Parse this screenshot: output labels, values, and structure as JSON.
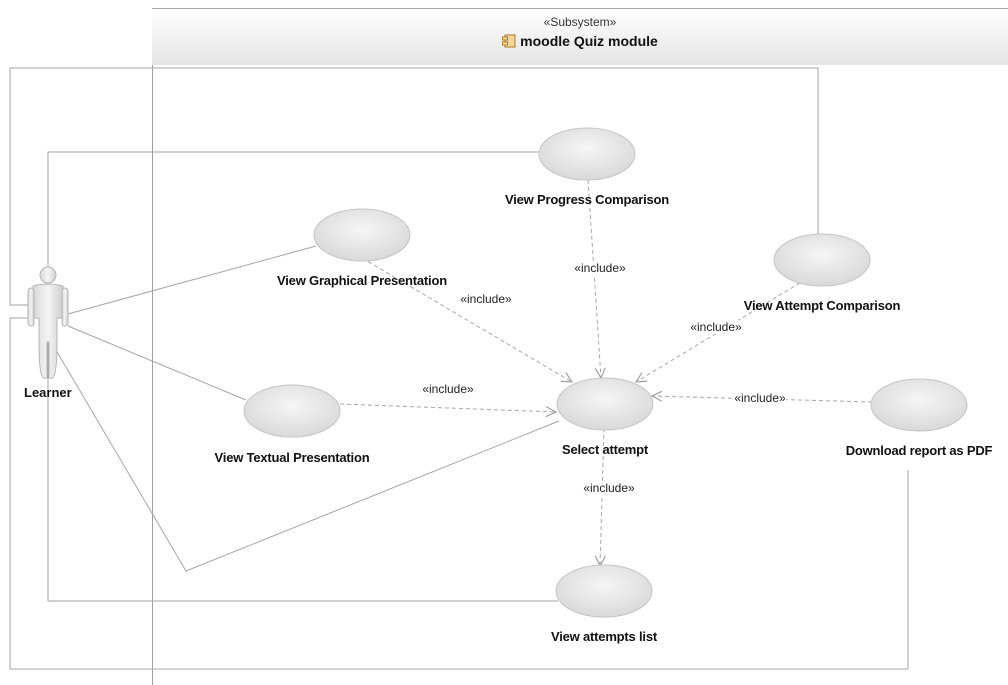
{
  "subsystem": {
    "stereotype": "«Subsystem»",
    "title": "moodle Quiz module",
    "icon": "component-icon"
  },
  "actor": {
    "name": "Learner",
    "icon": "stick-figure-actor"
  },
  "use_cases": {
    "view_progress_comparison": "View Progress Comparison",
    "view_graphical_presentation": "View Graphical Presentation",
    "view_attempt_comparison": "View Attempt Comparison",
    "view_textual_presentation": "View Textual Presentation",
    "select_attempt": "Select attempt",
    "download_report_pdf": "Download report as PDF",
    "view_attempts_list": "View attempts list"
  },
  "include_label": "«include»",
  "colors": {
    "ellipse_fill": "#e0e0e0",
    "ellipse_highlight": "#f4f4f4",
    "association_line": "#9a9a9a",
    "dependency_line": "#a8a8a8",
    "frame_line": "#a0a0a0"
  }
}
